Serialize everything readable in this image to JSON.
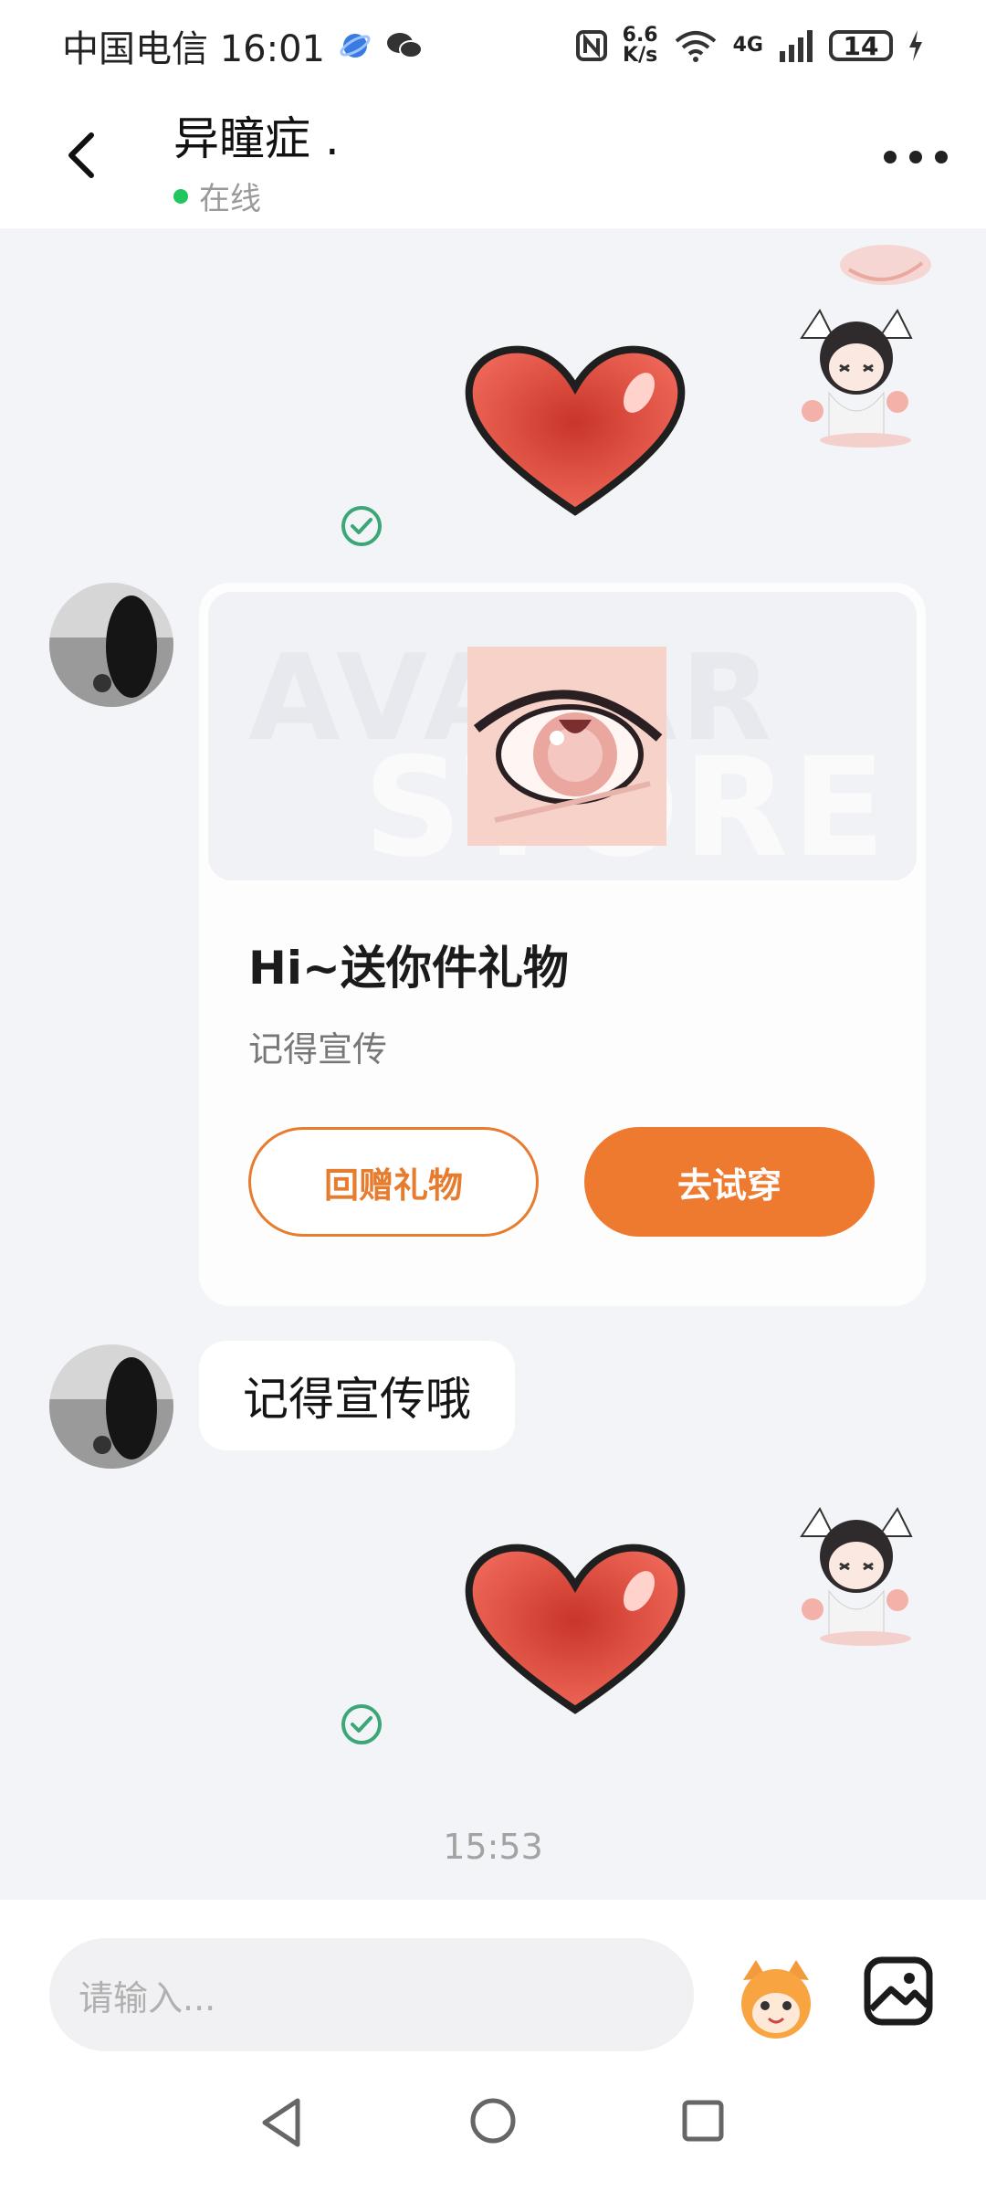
{
  "status_bar": {
    "carrier_time": "中国电信 16:01",
    "net_speed_top": "6.6",
    "net_speed_bottom": "K/s",
    "network": "4G",
    "battery": "14"
  },
  "header": {
    "title": "异瞳症 .",
    "status": "在线"
  },
  "gift_card": {
    "watermark_top": "AVATAR",
    "watermark_bottom": "STORE",
    "title": "Hi~送你件礼物",
    "subtitle": "记得宣传",
    "return_button": "回赠礼物",
    "try_button": "去试穿"
  },
  "messages": {
    "text_message": "记得宣传哦",
    "timestamp": "15:53"
  },
  "input": {
    "placeholder": "请输入..."
  },
  "colors": {
    "accent": "#ee7a30",
    "online": "#22c55e",
    "check": "#3aa775",
    "heart": "#e24a3e"
  },
  "icons": [
    "back-icon",
    "more-icon",
    "sent-check-icon",
    "emoji-icon",
    "image-icon",
    "nav-back-icon",
    "nav-home-icon",
    "nav-recent-icon"
  ]
}
